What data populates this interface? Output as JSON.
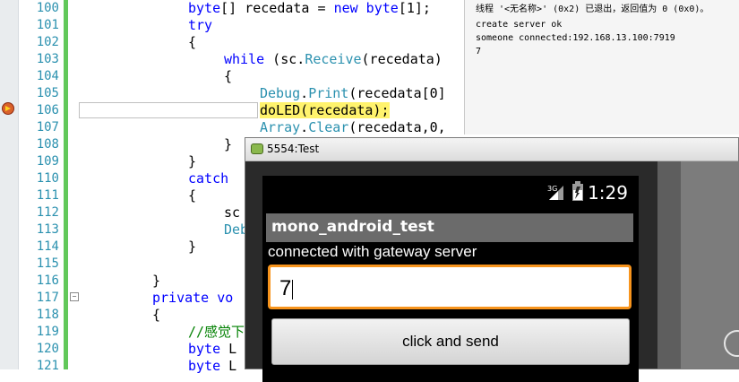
{
  "editor": {
    "line_numbers": [
      "100",
      "101",
      "102",
      "103",
      "104",
      "105",
      "106",
      "107",
      "108",
      "109",
      "110",
      "111",
      "112",
      "113",
      "114",
      "115",
      "116",
      "117",
      "118",
      "119",
      "120",
      "121"
    ],
    "lines": [
      {
        "indent": 120,
        "parts": [
          [
            "kw",
            "byte"
          ],
          [
            "",
            "[] recedata = "
          ],
          [
            "kw",
            "new"
          ],
          [
            "",
            ""
          ],
          [
            "kw",
            " byte"
          ],
          [
            "",
            "[1];"
          ]
        ]
      },
      {
        "indent": 120,
        "parts": [
          [
            "kw",
            "try"
          ]
        ]
      },
      {
        "indent": 120,
        "parts": [
          [
            "",
            "{"
          ]
        ]
      },
      {
        "indent": 160,
        "parts": [
          [
            "kw",
            "while"
          ],
          [
            "",
            " (sc."
          ],
          [
            "ty",
            "Receive"
          ],
          [
            "",
            "(recedata)"
          ]
        ]
      },
      {
        "indent": 160,
        "parts": [
          [
            "",
            "{"
          ]
        ]
      },
      {
        "indent": 200,
        "parts": [
          [
            "ty",
            "Debug"
          ],
          [
            "",
            "."
          ],
          [
            "ty",
            "Print"
          ],
          [
            "",
            "(recedata[0]"
          ]
        ]
      },
      {
        "indent": 200,
        "parts": [
          [
            "hl",
            "doLED(recedata);"
          ]
        ]
      },
      {
        "indent": 200,
        "parts": [
          [
            "ty",
            "Array"
          ],
          [
            "",
            "."
          ],
          [
            "ty",
            "Clear"
          ],
          [
            "",
            "(recedata,0,"
          ]
        ]
      },
      {
        "indent": 160,
        "parts": [
          [
            "",
            "}"
          ]
        ]
      },
      {
        "indent": 120,
        "parts": [
          [
            "",
            "}"
          ]
        ]
      },
      {
        "indent": 120,
        "parts": [
          [
            "kw",
            "catch"
          ]
        ]
      },
      {
        "indent": 120,
        "parts": [
          [
            "",
            "{"
          ]
        ]
      },
      {
        "indent": 160,
        "parts": [
          [
            "",
            "sc"
          ]
        ]
      },
      {
        "indent": 160,
        "parts": [
          [
            "ty",
            "Deb"
          ]
        ]
      },
      {
        "indent": 120,
        "parts": [
          [
            "",
            "}"
          ]
        ]
      },
      {
        "indent": 80,
        "parts": [
          [
            "",
            ""
          ]
        ]
      },
      {
        "indent": 80,
        "parts": [
          [
            "",
            "}"
          ]
        ]
      },
      {
        "indent": 80,
        "parts": [
          [
            "kw",
            "private"
          ],
          [
            "",
            " "
          ],
          [
            "kw",
            "vo"
          ]
        ]
      },
      {
        "indent": 80,
        "parts": [
          [
            "",
            "{"
          ]
        ]
      },
      {
        "indent": 120,
        "parts": [
          [
            "cm",
            "//感觉下"
          ]
        ]
      },
      {
        "indent": 120,
        "parts": [
          [
            "kw",
            "byte"
          ],
          [
            "",
            " L"
          ]
        ]
      },
      {
        "indent": 120,
        "parts": [
          [
            "kw",
            "byte"
          ],
          [
            "",
            " L"
          ]
        ]
      }
    ]
  },
  "output": {
    "lines": [
      "线程 '<无名称>' (0x2) 已退出，返回值为 0 (0x0)。",
      "create server ok",
      "someone connected:192.168.13.100:7919",
      "7"
    ]
  },
  "emulator": {
    "window_title": "5554:Test",
    "status_time": "1:29",
    "network_label": "3G",
    "app_title": "mono_android_test",
    "status_label": "connected with gateway server",
    "input_value": "7",
    "button_label": "click and send"
  },
  "colors": {
    "accent_focus": "#f7941d",
    "keyword": "#0000ff",
    "type": "#2b91af",
    "comment": "#008000",
    "current_statement": "#fff36d"
  }
}
